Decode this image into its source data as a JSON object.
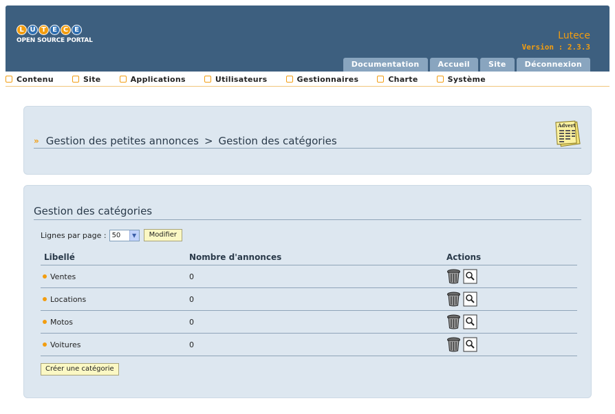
{
  "header": {
    "logo_letters": [
      "L",
      "U",
      "T",
      "E",
      "C",
      "E"
    ],
    "logo_subtitle": "OPEN SOURCE PORTAL",
    "app_name": "Lutece",
    "version": "Version : 2.3.3",
    "tabs": [
      "Documentation",
      "Accueil",
      "Site",
      "Déconnexion"
    ]
  },
  "menu": [
    "Contenu",
    "Site",
    "Applications",
    "Utilisateurs",
    "Gestionnaires",
    "Charte",
    "Système"
  ],
  "breadcrumb": {
    "parent": "Gestion des petites annonces",
    "separator": ">",
    "current": "Gestion des catégories"
  },
  "advert_icon_text": "Advert",
  "section": {
    "title": "Gestion des catégories",
    "perpage_label": "Lignes par page :",
    "perpage_value": "50",
    "modify_button": "Modifier",
    "columns": [
      "Libellé",
      "Nombre d'annonces",
      "Actions"
    ],
    "rows": [
      {
        "label": "Ventes",
        "count": "0"
      },
      {
        "label": "Locations",
        "count": "0"
      },
      {
        "label": "Motos",
        "count": "0"
      },
      {
        "label": "Voitures",
        "count": "0"
      }
    ],
    "create_button": "Créer une catégorie"
  },
  "colors": {
    "header_bg": "#3d5f7f",
    "accent": "#f29d10",
    "panel_bg": "#dde7f0",
    "tab_bg": "#89a5bf"
  }
}
